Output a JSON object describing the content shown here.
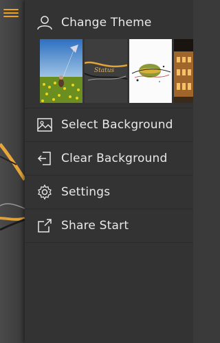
{
  "menu": {
    "items": [
      {
        "label": "Change Theme",
        "icon": "user-icon"
      },
      {
        "label": "Select Background",
        "icon": "image-icon"
      },
      {
        "label": "Clear Background",
        "icon": "exit-icon"
      },
      {
        "label": "Settings",
        "icon": "gear-icon"
      },
      {
        "label": "Share Start",
        "icon": "share-icon"
      }
    ]
  },
  "theme_thumbnails": [
    {
      "name": "kite-field"
    },
    {
      "name": "ribbon-script"
    },
    {
      "name": "colorful-sphere"
    },
    {
      "name": "colosseum"
    }
  ],
  "colors": {
    "accent": "#f2a21a",
    "drawer": "#333333",
    "text": "#e9e9e9"
  }
}
